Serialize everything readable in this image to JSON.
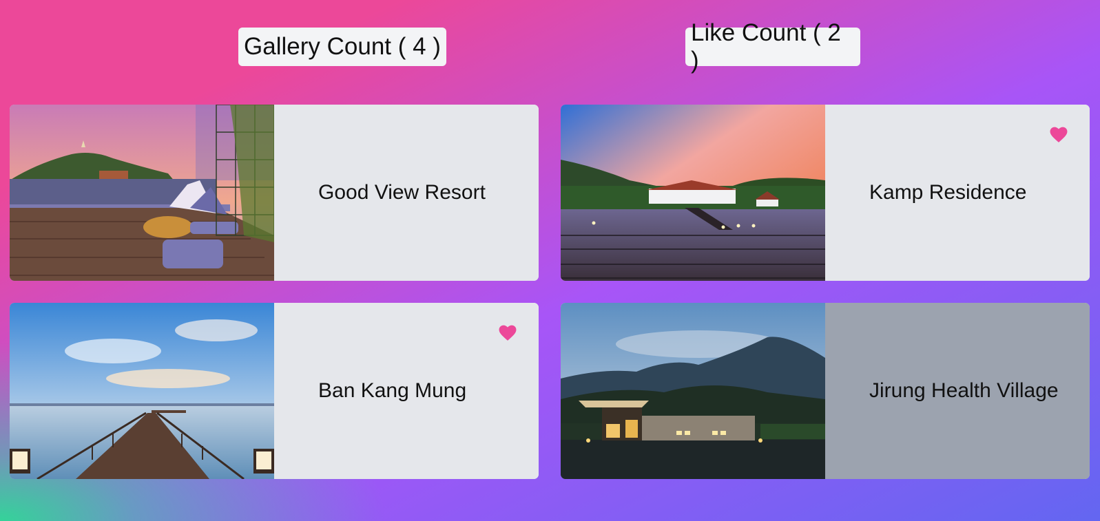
{
  "stats": {
    "gallery_label": "Gallery Count ( 4 )",
    "like_label": "Like Count ( 2 )"
  },
  "colors": {
    "heart": "#ec4899",
    "card_bg": "#e5e7eb",
    "card_selected_bg": "#9ca3af"
  },
  "cards": [
    {
      "name": "Good View Resort",
      "liked": false,
      "selected": false,
      "image": "rooftop-deck-sunset"
    },
    {
      "name": "Kamp Residence",
      "liked": true,
      "selected": false,
      "image": "pier-resort-sunset"
    },
    {
      "name": "Ban Kang Mung",
      "liked": true,
      "selected": false,
      "image": "wooden-jetty-sea"
    },
    {
      "name": "Jirung Health Village",
      "liked": false,
      "selected": true,
      "image": "house-mountain-dusk"
    }
  ]
}
